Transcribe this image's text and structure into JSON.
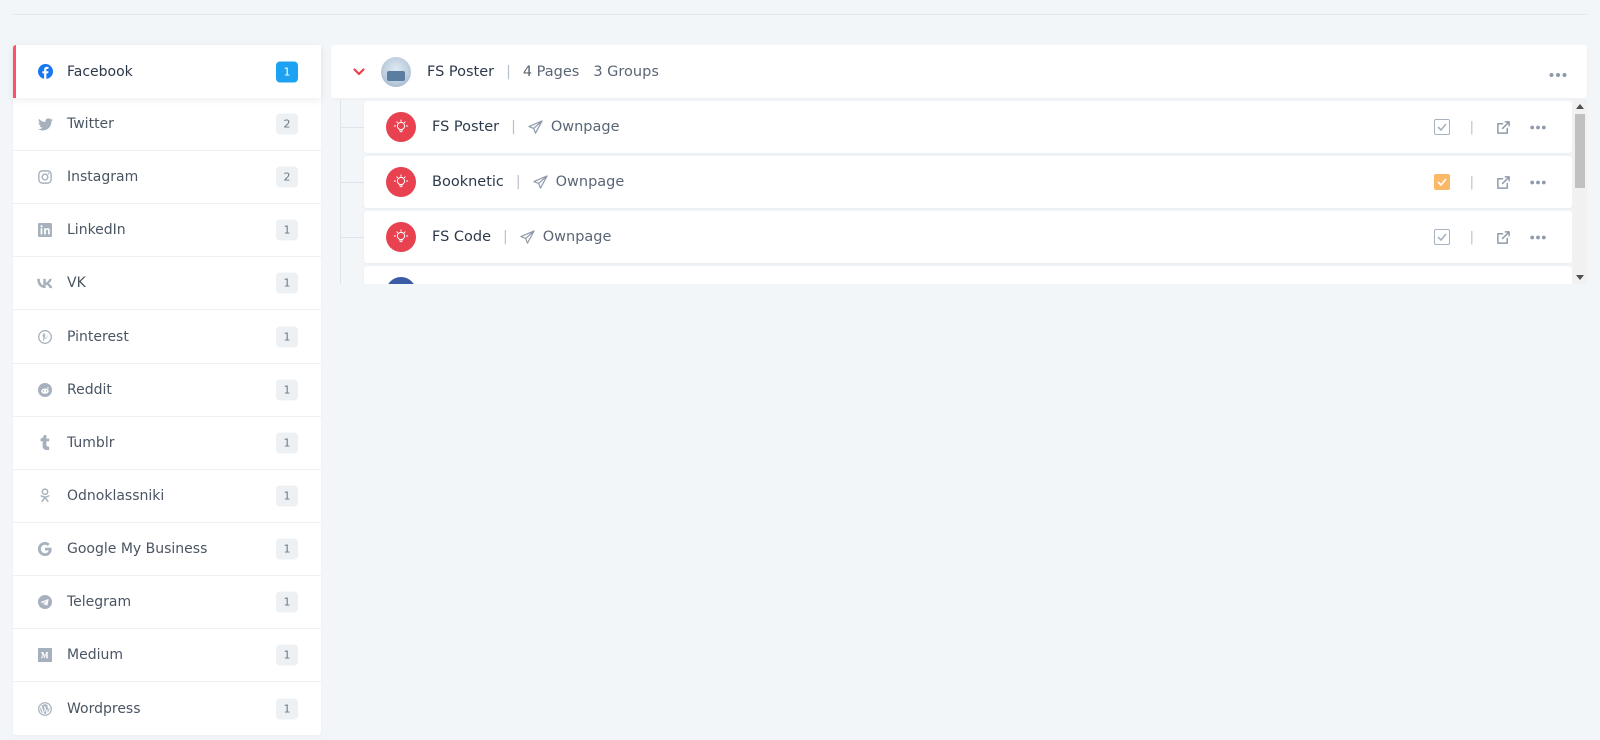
{
  "sidebar": {
    "items": [
      {
        "label": "Facebook",
        "count": "1",
        "icon": "facebook-icon"
      },
      {
        "label": "Twitter",
        "count": "2",
        "icon": "twitter-icon"
      },
      {
        "label": "Instagram",
        "count": "2",
        "icon": "instagram-icon"
      },
      {
        "label": "LinkedIn",
        "count": "1",
        "icon": "linkedin-icon"
      },
      {
        "label": "VK",
        "count": "1",
        "icon": "vk-icon"
      },
      {
        "label": "Pinterest",
        "count": "1",
        "icon": "pinterest-icon"
      },
      {
        "label": "Reddit",
        "count": "1",
        "icon": "reddit-icon"
      },
      {
        "label": "Tumblr",
        "count": "1",
        "icon": "tumblr-icon"
      },
      {
        "label": "Odnoklassniki",
        "count": "1",
        "icon": "odnoklassniki-icon"
      },
      {
        "label": "Google My Business",
        "count": "1",
        "icon": "google-icon"
      },
      {
        "label": "Telegram",
        "count": "1",
        "icon": "telegram-icon"
      },
      {
        "label": "Medium",
        "count": "1",
        "icon": "medium-icon"
      },
      {
        "label": "Wordpress",
        "count": "1",
        "icon": "wordpress-icon"
      }
    ],
    "active_index": 0
  },
  "group": {
    "name": "FS Poster",
    "separator": "|",
    "pages": "4 Pages",
    "groups": "3 Groups"
  },
  "nodes": [
    {
      "name": "FS Poster",
      "separator": "|",
      "type": "Ownpage",
      "checked": false
    },
    {
      "name": "Booknetic",
      "separator": "|",
      "type": "Ownpage",
      "checked": true
    },
    {
      "name": "FS Code",
      "separator": "|",
      "type": "Ownpage",
      "checked": false
    }
  ],
  "actions_separator": "|",
  "colors": {
    "accent_red": "#e8414f",
    "active_border": "#ff4f6a",
    "badge_active": "#1da1f2",
    "checked": "#fbb867",
    "facebook": "#1877f2"
  }
}
